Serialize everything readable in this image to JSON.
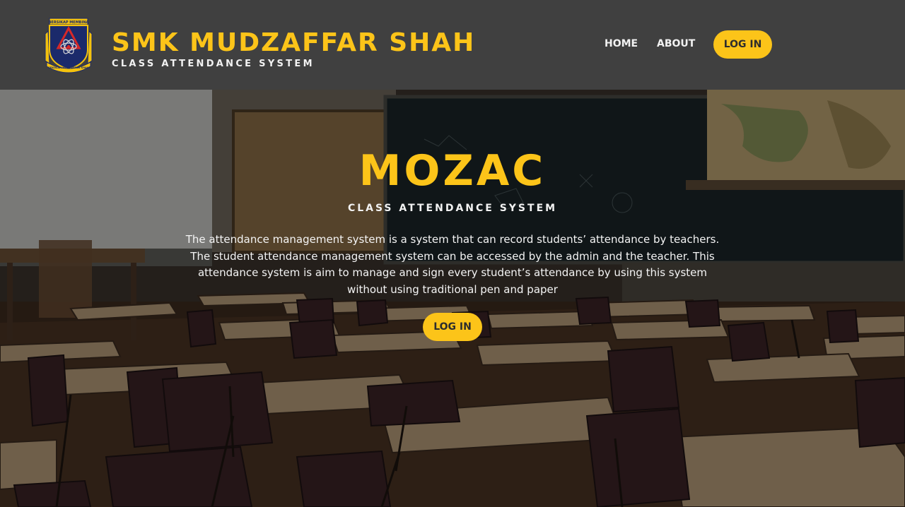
{
  "header": {
    "logo": {
      "icon": "school-crest-icon",
      "motto": "BERSIKAP MEMBINA",
      "ribbon": "SEKOLAH MUDZAFFAR SHAH"
    },
    "title": "SMK MUDZAFFAR SHAH",
    "subtitle": "CLASS ATTENDANCE SYSTEM",
    "nav": {
      "home": "HOME",
      "about": "ABOUT",
      "login": "LOG IN"
    }
  },
  "hero": {
    "background": "classroom-photo",
    "title": "MOZAC",
    "subtitle": "CLASS ATTENDANCE SYSTEM",
    "description": "The attendance management system is a system that can record students’ attendance by teachers. The student attendance management system can be accessed by the admin and the teacher. This attendance system is aim to manage and sign every student’s attendance by using this system without using traditional pen and paper",
    "login": "LOG IN"
  },
  "colors": {
    "accent": "#fcc419",
    "header_bg": "#404040",
    "text_light": "#f2f2f2"
  }
}
